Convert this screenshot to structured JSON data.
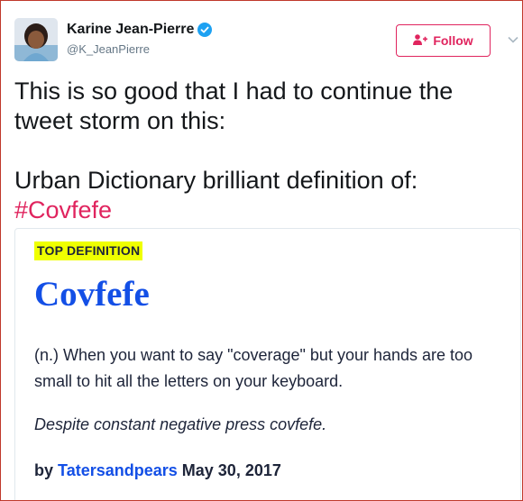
{
  "user": {
    "name": "Karine Jean-Pierre",
    "handle": "@K_JeanPierre",
    "verified": true
  },
  "follow_label": "Follow",
  "tweet": {
    "text": "This is so good that I had to continue the tweet storm on this:\n\nUrban Dictionary brilliant definition of: ",
    "hashtag": "#Covfefe"
  },
  "card": {
    "badge": "TOP DEFINITION",
    "word": "Covfefe",
    "meaning": "(n.) When you want to say \"coverage\" but your hands are too small to hit all the letters on your keyboard.",
    "example": "Despite constant negative press covfefe.",
    "by_label": "by",
    "author": "Tatersandpears",
    "date": "May 30, 2017"
  },
  "colors": {
    "accent": "#e0245e",
    "verified": "#1da1f2",
    "definition_blue": "#134fe6",
    "badge_yellow": "#efff00"
  }
}
